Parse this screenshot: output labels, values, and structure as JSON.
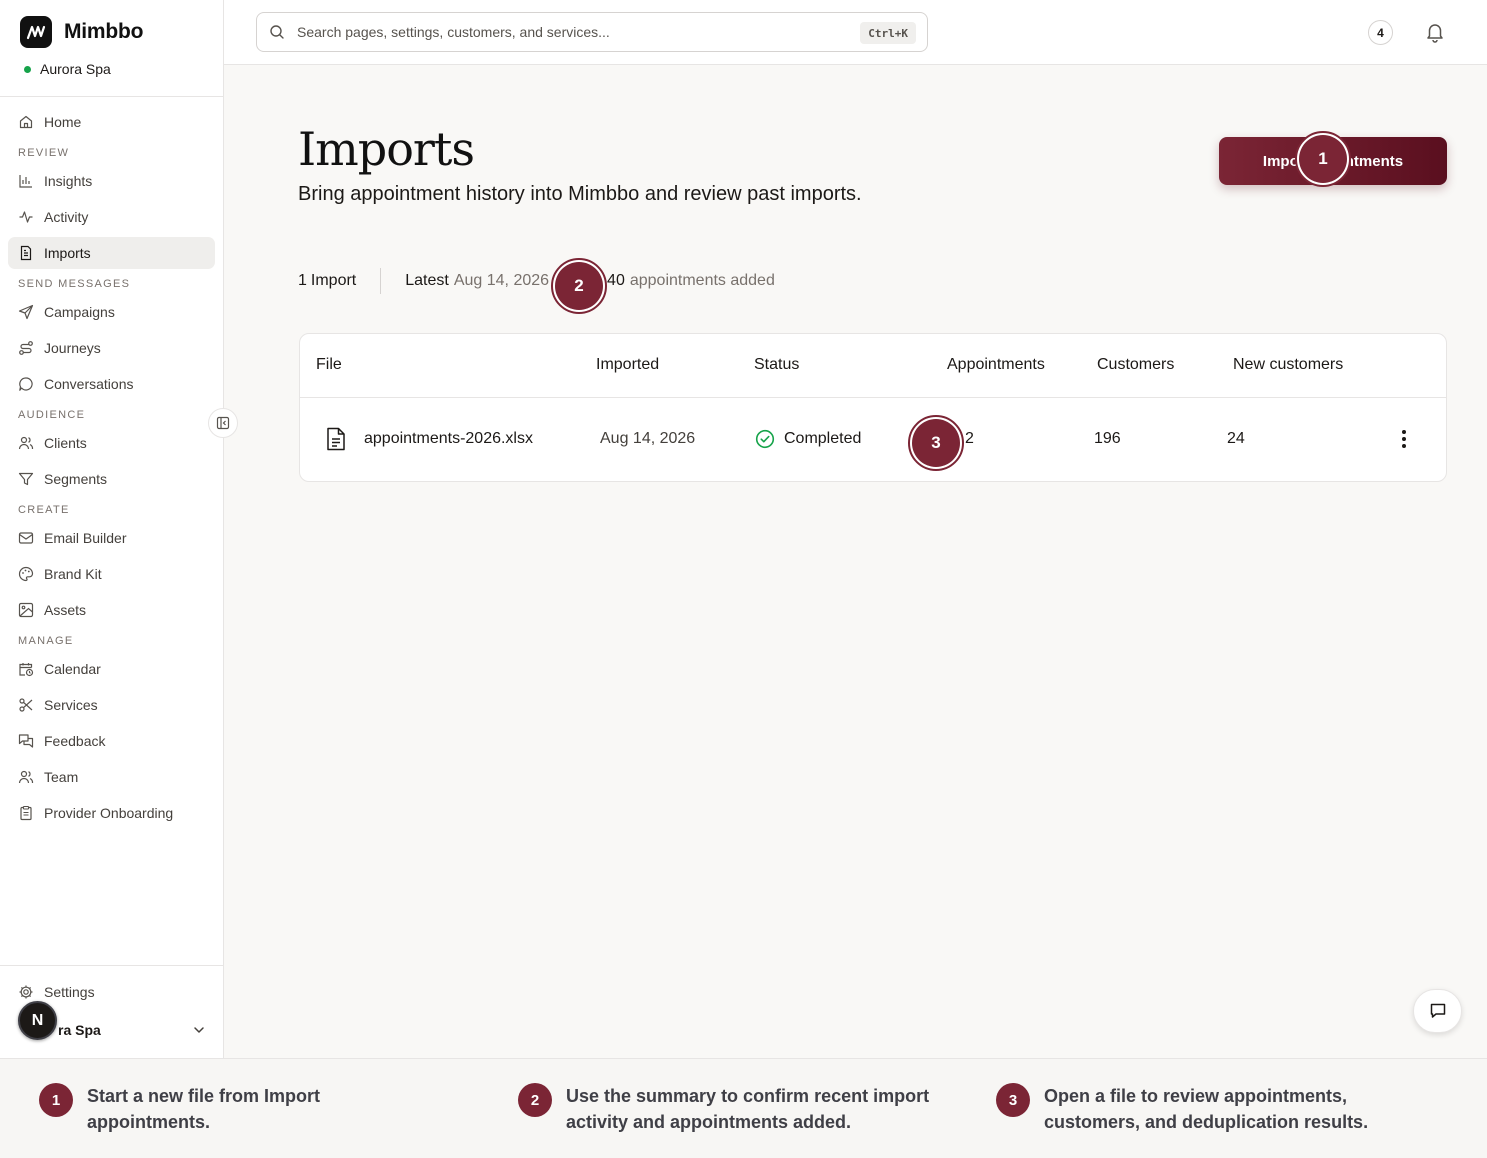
{
  "app": {
    "name": "Mimbbo",
    "workspace": "Aurora Spa"
  },
  "sidebar": {
    "home": "Home",
    "sections": {
      "review": "REVIEW",
      "send_messages": "SEND MESSAGES",
      "audience": "AUDIENCE",
      "create": "CREATE",
      "manage": "MANAGE"
    },
    "items": {
      "insights": "Insights",
      "activity": "Activity",
      "imports": "Imports",
      "campaigns": "Campaigns",
      "journeys": "Journeys",
      "conversations": "Conversations",
      "clients": "Clients",
      "segments": "Segments",
      "email_builder": "Email Builder",
      "brand_kit": "Brand Kit",
      "assets": "Assets",
      "calendar": "Calendar",
      "services": "Services",
      "feedback": "Feedback",
      "team": "Team",
      "provider_onboarding": "Provider Onboarding"
    },
    "settings": "Settings",
    "account_name": "ra Spa",
    "avatar_letter": "N"
  },
  "topbar": {
    "search_placeholder": "Search pages, settings, customers, and services...",
    "shortcut": "Ctrl+K",
    "notification_count": "4"
  },
  "page": {
    "title": "Imports",
    "subtitle": "Bring appointment history into Mimbbo and review past imports.",
    "primary_button_left": "Impo",
    "primary_button_right": "ntments"
  },
  "summary": {
    "imports_count": "1",
    "imports_label": "Import",
    "latest_label": "Latest",
    "latest_date": "Aug 14, 2026",
    "appointments_count": "40",
    "appointments_label": "appointments added"
  },
  "table": {
    "headers": {
      "file": "File",
      "imported": "Imported",
      "status": "Status",
      "appointments": "Appointments",
      "customers": "Customers",
      "new_customers": "New customers"
    },
    "rows": [
      {
        "file": "appointments-2026.xlsx",
        "imported": "Aug 14, 2026",
        "status": "Completed",
        "appointments": "2",
        "customers": "196",
        "new_customers": "24"
      }
    ]
  },
  "markers": {
    "one": "1",
    "two": "2",
    "three": "3"
  },
  "steps": [
    {
      "num": "1",
      "text_line1": "Start a new file from Import",
      "text_line2": "appointments."
    },
    {
      "num": "2",
      "text_line1": "Use the summary to confirm recent import",
      "text_line2": "activity and appointments added."
    },
    {
      "num": "3",
      "text_line1": "Open a file to review appointments,",
      "text_line2": "customers, and deduplication results."
    }
  ],
  "colors": {
    "accent": "#7b2535",
    "status_ok": "#16a34a"
  }
}
